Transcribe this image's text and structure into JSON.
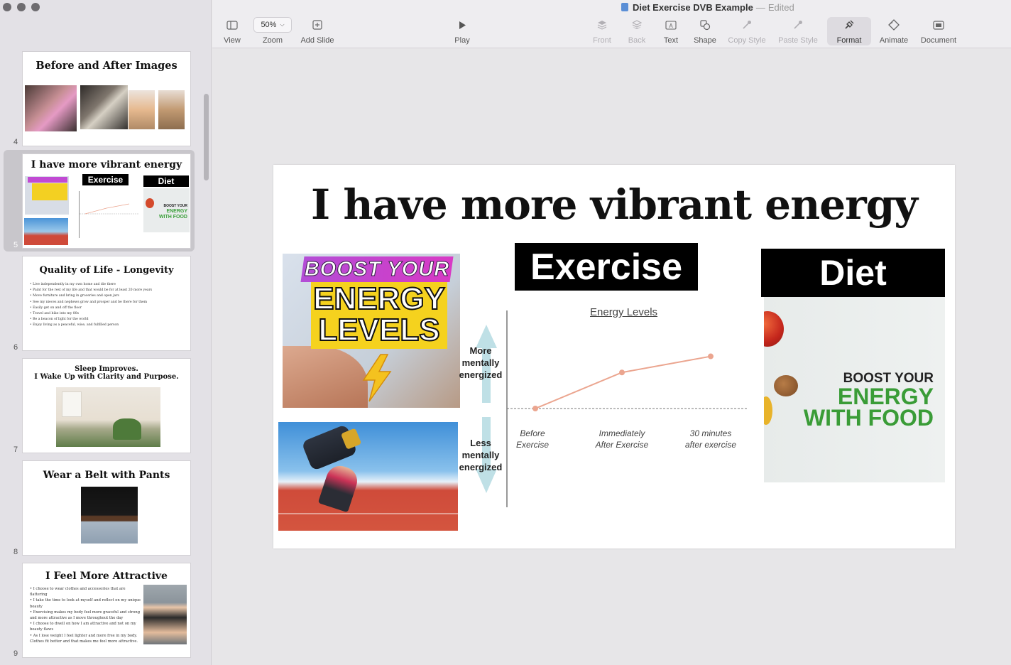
{
  "window": {
    "doc_title": "Diet Exercise DVB Example",
    "doc_status": "Edited"
  },
  "toolbar": {
    "view": "View",
    "zoom_value": "50%",
    "zoom": "Zoom",
    "add_slide": "Add Slide",
    "play": "Play",
    "front": "Front",
    "back": "Back",
    "text": "Text",
    "shape": "Shape",
    "copy_style": "Copy Style",
    "paste_style": "Paste Style",
    "format": "Format",
    "animate": "Animate",
    "document": "Document"
  },
  "slides": [
    {
      "number": "4",
      "title": "Before and After Images"
    },
    {
      "number": "5",
      "title": "I have more vibrant energy",
      "selected": true
    },
    {
      "number": "6",
      "title": "Quality of Life - Longevity",
      "bullets": [
        "Live independently in my own home and die there",
        "Paint for the rest of my life and that would be for at least 20 more years",
        "Move furniture and bring in groceries and open jars",
        "See my nieces and nephews grow and prosper and be there for them",
        "Easily get on and off the floor",
        "Travel and hike into my 80s",
        "Be a beacon of light for the world",
        "Enjoy living as a peaceful, wise, and fulfilled person"
      ]
    },
    {
      "number": "7",
      "title_line1": "Sleep Improves.",
      "title_line2": "I Wake Up with Clarity and Purpose."
    },
    {
      "number": "8",
      "title": "Wear a Belt with Pants"
    },
    {
      "number": "9",
      "title": "I Feel More Attractive",
      "bullets": [
        "I choose to wear clothes and accessories that are flattering",
        "I take the time to look at myself and reflect on my unique beauty",
        "Exercising makes my body feel more graceful and strong and more attractive as I move throughout the day",
        "I choose to dwell on how I am attractive and not on my beauty flaws",
        "As I lose weight I feel lighter and more free in my body. Clothes fit better and that makes me feel more attractive."
      ]
    }
  ],
  "slide": {
    "title": "I have more vibrant energy",
    "boost_top": "BOOST YOUR",
    "boost_line1": "ENERGY",
    "boost_line2": "LEVELS",
    "exercise_label": "Exercise",
    "diet_label": "Diet",
    "food_line1": "BOOST YOUR",
    "food_line2": "ENERGY",
    "food_line3": "WITH FOOD"
  },
  "chart_data": {
    "type": "line",
    "title": "Energy Levels",
    "categories": [
      "Before Exercise",
      "Immediately After Exercise",
      "30 minutes after exercise"
    ],
    "category_lines": [
      [
        "Before",
        "Exercise"
      ],
      [
        "Immediately",
        "After Exercise"
      ],
      [
        "30 minutes",
        "after exercise"
      ]
    ],
    "values": [
      0,
      0.47,
      0.68
    ],
    "ylabel_top": [
      "More",
      "mentally",
      "energized"
    ],
    "ylabel_bottom": [
      "Less",
      "mentally",
      "energized"
    ],
    "baseline": "dashed",
    "grid": false,
    "line_color": "#eba58f"
  }
}
